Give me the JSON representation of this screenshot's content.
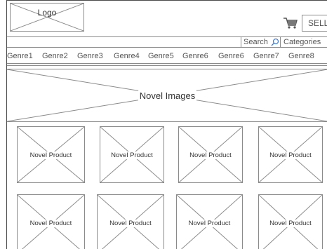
{
  "header": {
    "logo_label": "Logo",
    "cart_icon": "shopping-cart-icon",
    "sell_label": "SELL"
  },
  "search_bar": {
    "search_label": "Search",
    "search_icon": "magnifier-icon",
    "categories_label": "Categories"
  },
  "genres": [
    "Genre1",
    "Genre2",
    "Genre3",
    "Genre4",
    "Genre5",
    "Genre6",
    "Genre6",
    "Genre7",
    "Genre8"
  ],
  "hero": {
    "label": "Novel Images"
  },
  "products": [
    {
      "label": "Novel Product"
    },
    {
      "label": "Novel Product"
    },
    {
      "label": "Novel Product"
    },
    {
      "label": "Novel Product"
    },
    {
      "label": "Novel Product"
    },
    {
      "label": "Novel Product"
    },
    {
      "label": "Novel Product"
    },
    {
      "label": "Novel Product"
    }
  ]
}
